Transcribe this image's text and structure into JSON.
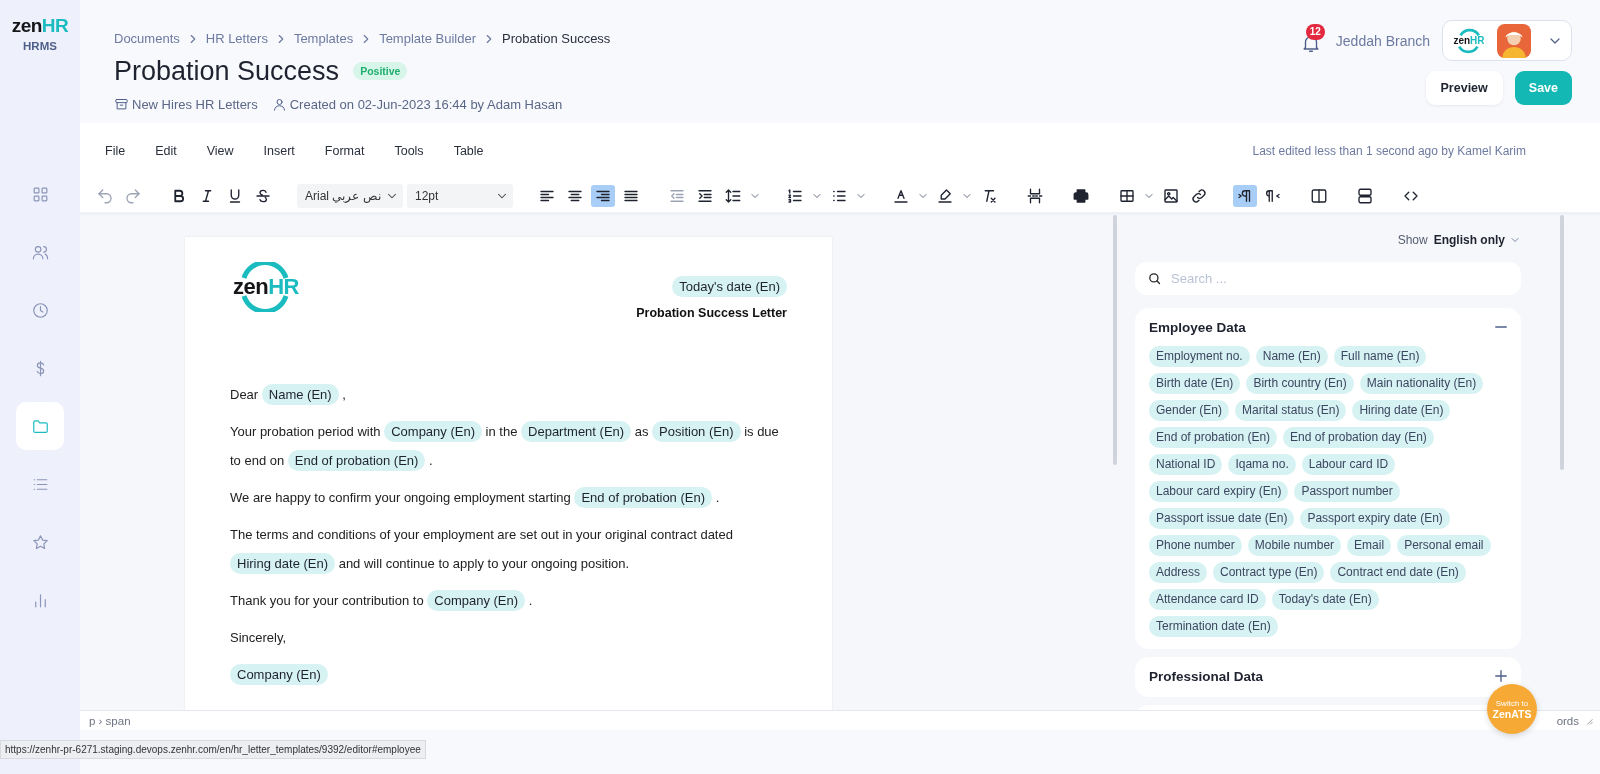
{
  "app": {
    "logo": {
      "text": "zen",
      "accent": "HR"
    },
    "product": "HRMS"
  },
  "nav": [
    {
      "kind": "dashboard",
      "selected": false
    },
    {
      "kind": "people",
      "selected": false
    },
    {
      "kind": "time",
      "selected": false
    },
    {
      "kind": "payroll",
      "selected": false
    },
    {
      "kind": "documents",
      "selected": true
    },
    {
      "kind": "list",
      "selected": false
    },
    {
      "kind": "star",
      "selected": false
    },
    {
      "kind": "reports",
      "selected": false
    }
  ],
  "breadcrumb": [
    "Documents",
    "HR Letters",
    "Templates",
    "Template Builder",
    "Probation Success"
  ],
  "page": {
    "title": "Probation Success",
    "badge": "Positive",
    "category": "New Hires HR Letters",
    "created": "Created on 02-Jun-2023 16:44 by Adam Hasan"
  },
  "topbar": {
    "notifications": "12",
    "branch": "Jeddah Branch",
    "account_logo": {
      "text": "zen",
      "accent": "HR"
    }
  },
  "actions": [
    {
      "kind": "secondary",
      "label": "Preview"
    },
    {
      "kind": "primary",
      "label": "Save"
    }
  ],
  "menu": [
    "File",
    "Edit",
    "View",
    "Insert",
    "Format",
    "Tools",
    "Table"
  ],
  "last_edited": "Last edited less than 1 second ago by Kamel Karim",
  "toolbar": [
    [
      {
        "kind": "undo",
        "selected": false,
        "disabled": true
      },
      {
        "kind": "redo",
        "selected": false,
        "disabled": true
      }
    ],
    [
      {
        "kind": "bold",
        "selected": false
      },
      {
        "kind": "italic",
        "selected": false
      },
      {
        "kind": "underline",
        "selected": false
      },
      {
        "kind": "strike",
        "selected": false
      }
    ],
    [
      {
        "kind": "select",
        "value": "Arial نص عربي"
      },
      {
        "kind": "select",
        "value": "12pt"
      }
    ],
    [
      {
        "kind": "align-left",
        "selected": false
      },
      {
        "kind": "align-center",
        "selected": false
      },
      {
        "kind": "align-right",
        "selected": true
      },
      {
        "kind": "justify",
        "selected": false
      }
    ],
    [
      {
        "kind": "outdent",
        "selected": false,
        "disabled": true
      },
      {
        "kind": "indent",
        "selected": false
      },
      {
        "kind": "line-height",
        "selected": false,
        "dropdown": true
      }
    ],
    [
      {
        "kind": "numbered-list",
        "selected": false,
        "dropdown": true
      },
      {
        "kind": "bullet-list",
        "selected": false,
        "dropdown": true
      }
    ],
    [
      {
        "kind": "text-color",
        "selected": false,
        "dropdown": true
      },
      {
        "kind": "highlight",
        "selected": false,
        "dropdown": true
      },
      {
        "kind": "clear-format",
        "selected": false
      }
    ],
    [
      {
        "kind": "page-break",
        "selected": false
      }
    ],
    [
      {
        "kind": "print",
        "selected": false
      }
    ],
    [
      {
        "kind": "table",
        "selected": false,
        "dropdown": true
      },
      {
        "kind": "image",
        "selected": false
      },
      {
        "kind": "link",
        "selected": false
      }
    ],
    [
      {
        "kind": "ltr",
        "selected": true
      },
      {
        "kind": "rtl",
        "selected": false
      }
    ],
    [
      {
        "kind": "columns",
        "selected": false
      }
    ],
    [
      {
        "kind": "rows",
        "selected": false
      }
    ],
    [
      {
        "kind": "code",
        "selected": false
      }
    ]
  ],
  "letter": {
    "logo": {
      "text": "zen",
      "accent": "HR"
    },
    "date": "Today's date (En)",
    "heading": "Probation Success Letter",
    "paragraphs": [
      [
        {
          "kind": "text",
          "text": "Dear "
        },
        {
          "kind": "field",
          "text": "Name (En)"
        },
        {
          "kind": "text",
          "text": " ,"
        }
      ],
      [
        {
          "kind": "text",
          "text": "Your probation period with "
        },
        {
          "kind": "field",
          "text": "Company (En)"
        },
        {
          "kind": "text",
          "text": " in the "
        },
        {
          "kind": "field",
          "text": "Department (En)"
        },
        {
          "kind": "text",
          "text": " as "
        },
        {
          "kind": "field",
          "text": "Position (En)"
        },
        {
          "kind": "text",
          "text": " is due to end on "
        },
        {
          "kind": "field",
          "text": "End of probation (En)"
        },
        {
          "kind": "text",
          "text": " ."
        }
      ],
      [
        {
          "kind": "text",
          "text": "We are happy to confirm your ongoing employment starting "
        },
        {
          "kind": "field",
          "text": "End of probation (En)"
        },
        {
          "kind": "text",
          "text": " ."
        }
      ],
      [
        {
          "kind": "text",
          "text": "The terms and conditions of your employment are set out in your original contract dated "
        },
        {
          "kind": "field",
          "text": "Hiring date (En)"
        },
        {
          "kind": "text",
          "text": " and will continue to apply to your ongoing position."
        }
      ],
      [
        {
          "kind": "text",
          "text": "Thank you for your contribution to "
        },
        {
          "kind": "field",
          "text": "Company (En)"
        },
        {
          "kind": "text",
          "text": " ."
        }
      ],
      [
        {
          "kind": "text",
          "text": "Sincerely,"
        }
      ],
      [
        {
          "kind": "field",
          "text": "Company (En)"
        }
      ]
    ]
  },
  "status_bar": {
    "path": "p › span",
    "words": "ords"
  },
  "fields_panel": {
    "show_label": "Show",
    "show_value": "English only",
    "search": {
      "placeholder": "Search ..."
    },
    "groups": [
      {
        "title": "Employee Data",
        "expanded": true,
        "fields": [
          "Employment no.",
          "Name (En)",
          "Full name (En)",
          "Birth date (En)",
          "Birth country (En)",
          "Main nationality (En)",
          "Gender (En)",
          "Marital status (En)",
          "Hiring date (En)",
          "End of probation (En)",
          "End of probation day (En)",
          "National ID",
          "Iqama no.",
          "Labour card ID",
          "Labour card expiry (En)",
          "Passport number",
          "Passport issue date (En)",
          "Passport expiry date (En)",
          "Phone number",
          "Mobile number",
          "Email",
          "Personal email",
          "Address",
          "Contract type (En)",
          "Contract end date (En)",
          "Attendance card ID",
          "Today's date (En)",
          "Termination date (En)"
        ]
      },
      {
        "title": "Professional Data",
        "expanded": false
      }
    ]
  },
  "switch_button": {
    "line1": "Switch to",
    "line2": "ZenATS"
  },
  "status_url": "https://zenhr-pr-6271.staging.devops.zenhr.com/en/hr_letter_templates/9392/editor#employee"
}
